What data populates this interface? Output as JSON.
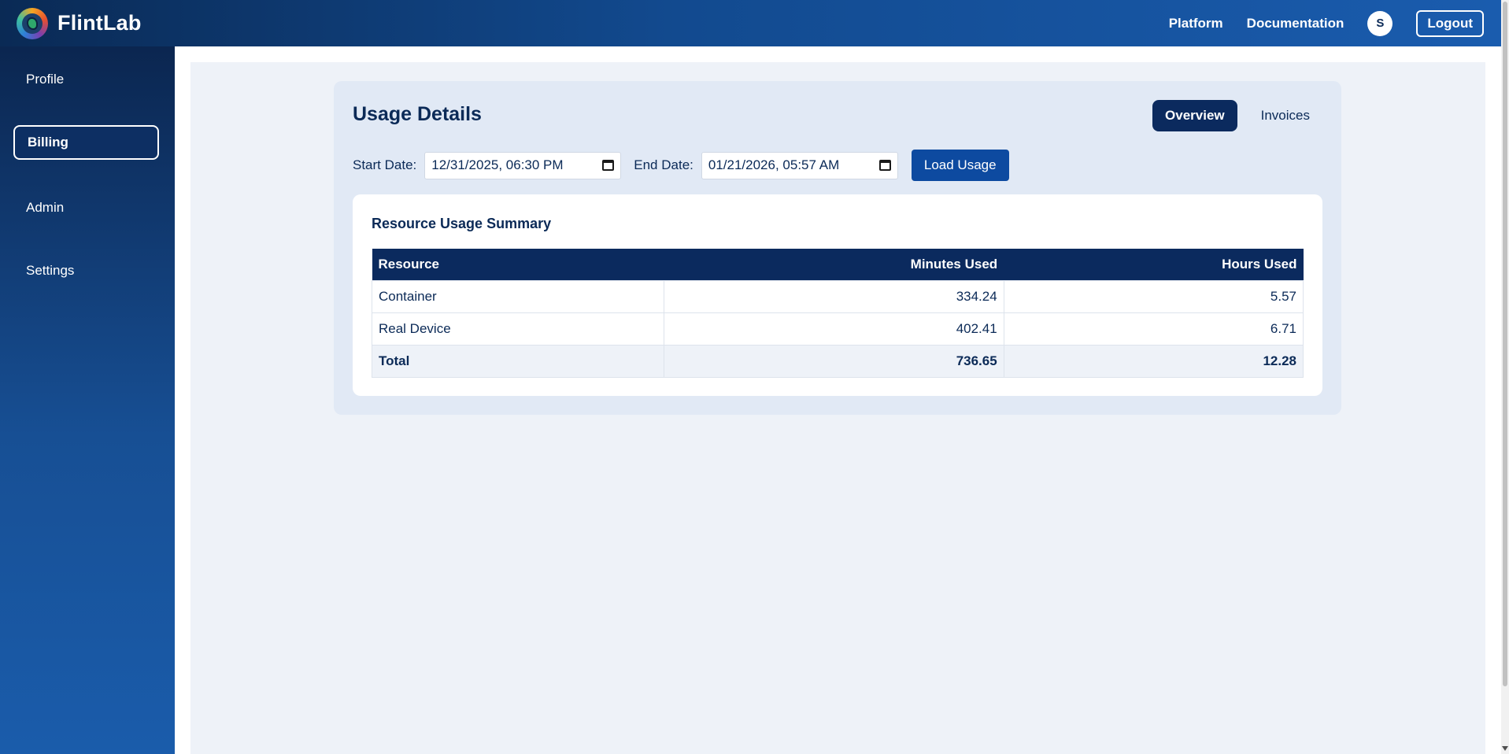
{
  "brand": {
    "name": "FlintLab",
    "logo_icon": "flintlab-logo-icon"
  },
  "header": {
    "nav": {
      "platform": "Platform",
      "documentation": "Documentation"
    },
    "avatar_initial": "S",
    "logout_label": "Logout"
  },
  "sidebar": {
    "items": [
      {
        "label": "Profile",
        "active": false
      },
      {
        "label": "Billing",
        "active": true
      },
      {
        "label": "Admin",
        "active": false
      },
      {
        "label": "Settings",
        "active": false
      }
    ]
  },
  "usage": {
    "title": "Usage Details",
    "tabs": [
      {
        "label": "Overview",
        "active": true
      },
      {
        "label": "Invoices",
        "active": false
      }
    ],
    "filters": {
      "start_label": "Start Date:",
      "start_value": "12/31/2025, 06:30 PM",
      "end_label": "End Date:",
      "end_value": "01/21/2026, 05:57 AM",
      "load_button": "Load Usage"
    },
    "summary": {
      "title": "Resource Usage Summary",
      "columns": [
        "Resource",
        "Minutes Used",
        "Hours Used"
      ],
      "rows": [
        {
          "resource": "Container",
          "minutes": "334.24",
          "hours": "5.57"
        },
        {
          "resource": "Real Device",
          "minutes": "402.41",
          "hours": "6.71"
        }
      ],
      "total": {
        "resource": "Total",
        "minutes": "736.65",
        "hours": "12.28"
      }
    }
  },
  "colors": {
    "header_gradient": [
      "#0a2a55",
      "#1a5cae"
    ],
    "accent_dark": "#0b2a5e",
    "button_blue": "#0d4aa0",
    "card_bg": "#e1e9f5",
    "main_bg": "#eef2f8"
  }
}
